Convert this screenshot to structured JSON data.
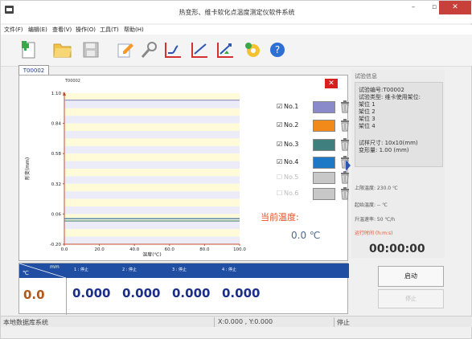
{
  "window": {
    "title": "热变形、维卡软化点温度测定仪软件系统",
    "min": "–",
    "max": "▫",
    "close": "✕"
  },
  "menu": [
    "文件(F)",
    "编辑(E)",
    "查看(V)",
    "操作(O)",
    "工具(T)",
    "帮助(H)"
  ],
  "toolbar": [
    "new-icon",
    "open-folder-icon",
    "save-icon",
    "edit-icon",
    "search-icon",
    "chart-curve-1-icon",
    "chart-curve-2-icon",
    "chart-curve-3-icon",
    "settings-icon",
    "help-icon"
  ],
  "tab": {
    "label": "T00002"
  },
  "chart": {
    "title": "T00002",
    "close_label": "✕"
  },
  "legend": [
    {
      "check": "☑",
      "label": "No.1",
      "color": "#8a89c9",
      "enabled": true
    },
    {
      "check": "☑",
      "label": "No.2",
      "color": "#f28a1a",
      "enabled": true
    },
    {
      "check": "☑",
      "label": "No.3",
      "color": "#3f7f7d",
      "enabled": true
    },
    {
      "check": "☑",
      "label": "No.4",
      "color": "#1d79c6",
      "enabled": true
    },
    {
      "check": "☐",
      "label": "No.5",
      "color": "#c8c8c8",
      "enabled": false
    },
    {
      "check": "☐",
      "label": "No.6",
      "color": "#c8c8c8",
      "enabled": false
    }
  ],
  "current_temp": {
    "label": "当前温度:",
    "value": "0.0 ℃"
  },
  "info": {
    "header": "试验信息",
    "lines": [
      "试验编号:T00002",
      "试验类型: 维卡使用架位:",
      "架位 1",
      "架位 2",
      "架位 3",
      "架位 4",
      "",
      "试样尺寸: 10x10(mm)",
      "变形量: 1.00 (mm)"
    ],
    "upper_limit": "上限温度: 230.0 ℃",
    "start_temp": "起始温度: -- ℃",
    "rate": "升温速率: 50 ℃/h",
    "runtime_label": "运行时间 (h:m:s)",
    "runtime": "00:00:00"
  },
  "bottom": {
    "unit_mm": "mm",
    "unit_c": "℃",
    "channels": [
      "1 : 停止",
      "2 : 停止",
      "3 : 停止",
      "4 : 停止"
    ],
    "temp": "0.0",
    "values": [
      "0.000",
      "0.000",
      "0.000",
      "0.000"
    ]
  },
  "buttons": {
    "start": "启动",
    "stop": "停止"
  },
  "status": {
    "db": "本地数据库系统",
    "xy": "X:0.000 , Y:0.000",
    "state": "停止"
  },
  "chart_data": {
    "type": "line",
    "title": "T00002",
    "xlabel": "温度(℃)",
    "ylabel": "形变(mm)",
    "xlim": [
      0,
      100
    ],
    "ylim": [
      -0.2,
      1.1
    ],
    "x_ticks": [
      "0.0",
      "20.0",
      "40.0",
      "60.0",
      "80.0",
      "100.0"
    ],
    "y_ticks": [
      "-0.20",
      "0.06",
      "0.32",
      "0.58",
      "0.84",
      "1.10"
    ],
    "series": [
      {
        "name": "No.1",
        "color": "#8a89c9",
        "x": [
          0,
          100
        ],
        "y": [
          1.04,
          1.04
        ]
      },
      {
        "name": "No.2",
        "color": "#f28a1a",
        "x": [
          0,
          100
        ],
        "y": [
          0.02,
          0.02
        ]
      },
      {
        "name": "No.3",
        "color": "#3f7f7d",
        "x": [
          0,
          100
        ],
        "y": [
          0.0,
          0.0
        ]
      },
      {
        "name": "No.4",
        "color": "#1d79c6",
        "x": [
          0,
          100
        ],
        "y": [
          0.02,
          0.02
        ]
      }
    ]
  }
}
